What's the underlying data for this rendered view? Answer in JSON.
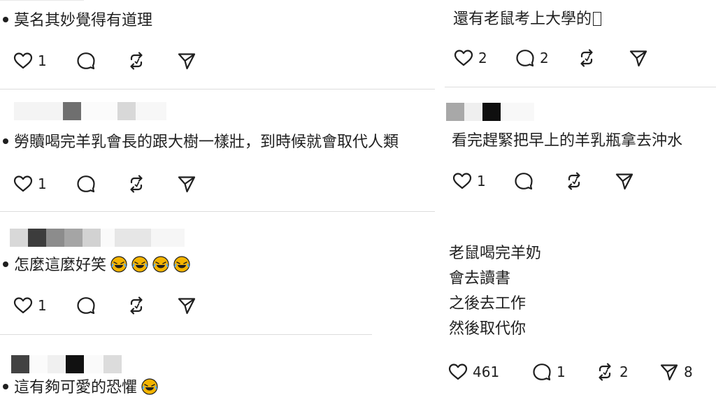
{
  "comments_left": [
    {
      "text": "莫名其妙覺得有道理",
      "likes": "1"
    },
    {
      "text": "勞贖喝完羊乳會長的跟大樹一樣壯，到時候就會取代人類",
      "likes": "1"
    },
    {
      "text": "怎麼這麼好笑",
      "likes": "1",
      "emoji": "rolling-on-floor-laughing-emoji"
    },
    {
      "text": "這有夠可愛的恐懼",
      "emoji": "rolling-on-floor-laughing-emoji"
    }
  ],
  "comments_right": [
    {
      "text": "還有老鼠考上大學的",
      "likes": "2",
      "replies": "2"
    },
    {
      "text": "看完趕緊把早上的羊乳瓶拿去沖水",
      "likes": "1"
    }
  ],
  "post": {
    "lines": [
      "老鼠喝完羊奶",
      "會去讀書",
      "之後去工作",
      "然後取代你"
    ],
    "likes": "461",
    "replies": "1",
    "reposts": "2",
    "shares": "8"
  },
  "icons": {
    "like": "heart-icon",
    "reply": "reply-bubble-icon",
    "repost": "repost-icon",
    "share": "share-icon"
  },
  "colors": {
    "text": "#1f1f1f",
    "divider": "#dddddd",
    "emoji": "#f4b400"
  }
}
